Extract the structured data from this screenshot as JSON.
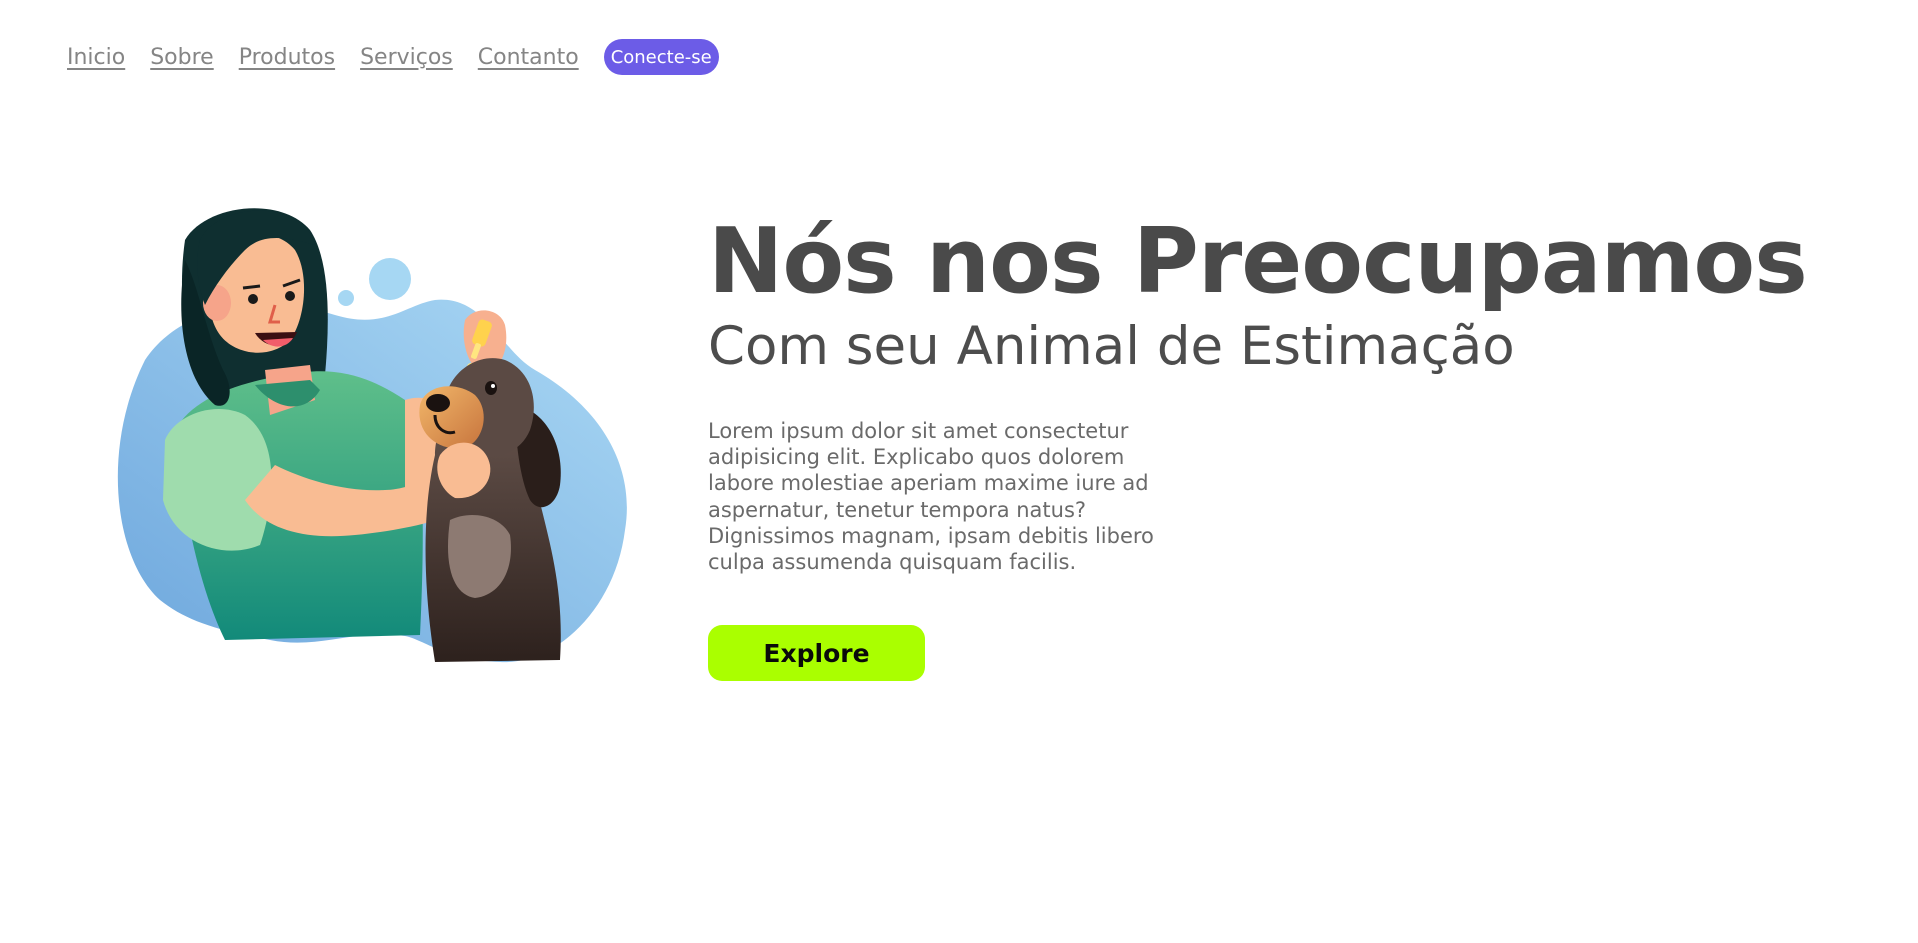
{
  "nav": {
    "links": [
      {
        "label": "Inicio"
      },
      {
        "label": "Sobre"
      },
      {
        "label": "Produtos"
      },
      {
        "label": "Serviços"
      },
      {
        "label": "Contanto"
      }
    ],
    "cta_label": "Conecte-se"
  },
  "hero": {
    "title": "Nós nos Preocupamos",
    "subtitle": "Com seu Animal de Estimação",
    "body": "Lorem ipsum dolor sit amet consectetur adipisicing elit. Explicabo quos dolorem labore molestiae aperiam maxime iure ad aspernatur, tenetur tempora natus? Dignissimos magnam, ipsam debitis libero culpa assumenda quisquam facilis.",
    "button_label": "Explore"
  },
  "illustration": {
    "icon": "vet-woman-with-dog-illustration"
  },
  "colors": {
    "accent": "#6c5ce7",
    "button": "#aaff00",
    "heading": "#4a4a4a",
    "nav_link": "#858585",
    "blob_blue": "#8fc4ec",
    "shirt_green": "#3aa57f",
    "dog_brown": "#4b3a33"
  }
}
